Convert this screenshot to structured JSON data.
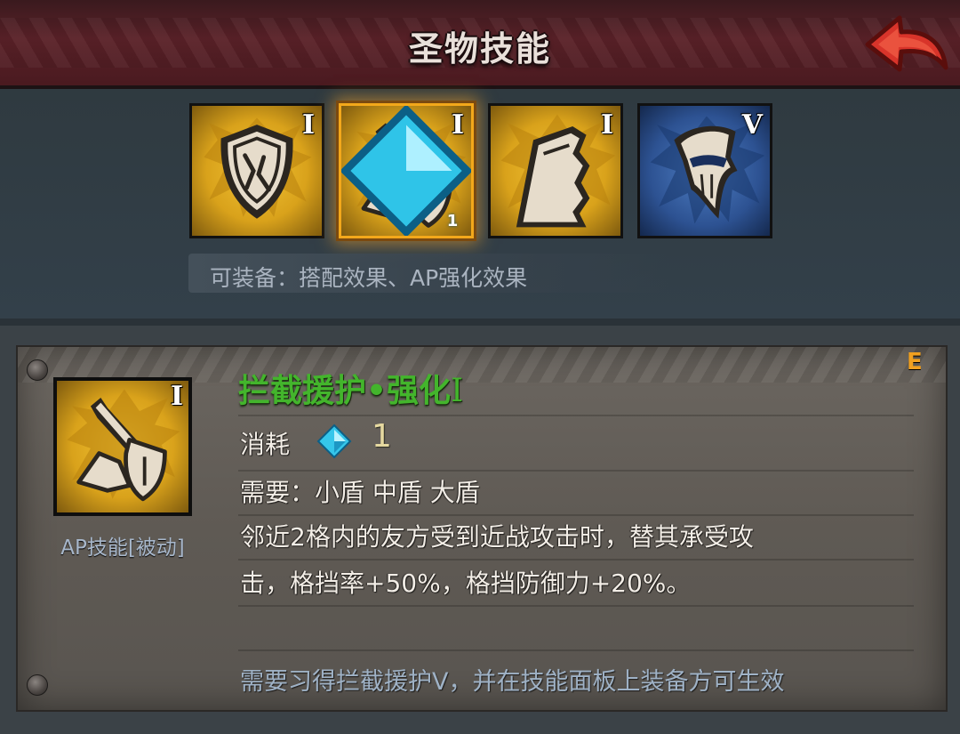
{
  "header": {
    "title": "圣物技能"
  },
  "slots": [
    {
      "icon": "shield-icon",
      "level": "I",
      "selected": false
    },
    {
      "icon": "sword-shield-icon",
      "level": "I",
      "selected": true,
      "badge": "1"
    },
    {
      "icon": "broken-wall-icon",
      "level": "I",
      "selected": false
    },
    {
      "icon": "helmet-mask-icon",
      "level": "V",
      "selected": false
    }
  ],
  "equip_note": "可装备：搭配效果、AP强化效果",
  "detail": {
    "corner_label": "E",
    "icon_level": "I",
    "type_label": "AP技能[被动]",
    "name": "拦截援护•强化",
    "name_level": "I",
    "cost_label": "消耗",
    "cost_value": "1",
    "require": "需要：小盾 中盾 大盾",
    "desc_line1": "邻近2格内的友方受到近战攻击时，替其承受攻",
    "desc_line2": "击，格挡率+50%，格挡防御力+20%。",
    "footer": "需要习得拦截援护V，并在技能面板上装备方可生效"
  },
  "colors": {
    "header_bg": "#5a2128",
    "gold_icon": "#d9a21b",
    "blue_icon": "#2d5292",
    "selected_border": "#f3a81b",
    "skill_name": "#43b52c",
    "back_arrow": "#d8342a"
  }
}
